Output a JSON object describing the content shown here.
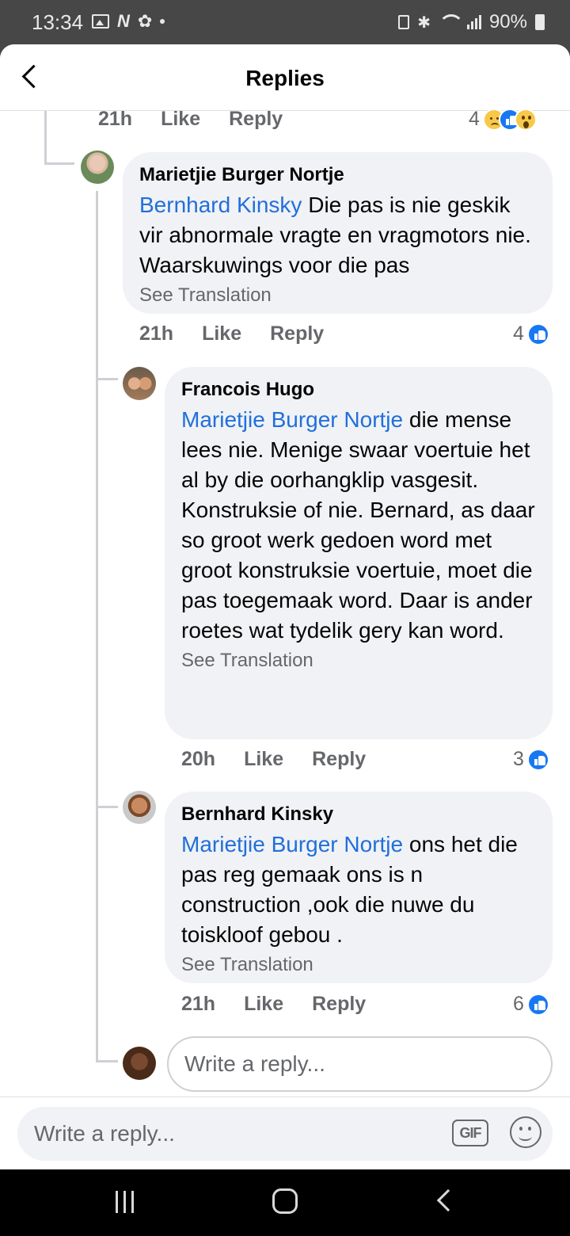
{
  "status_bar": {
    "time": "13:34",
    "battery": "90%"
  },
  "header": {
    "title": "Replies"
  },
  "top_row": {
    "time": "21h",
    "like": "Like",
    "reply": "Reply",
    "reaction_count": "4"
  },
  "comments": [
    {
      "author": "Marietjie Burger Nortje",
      "mention": "Bernhard Kinsky",
      "text": " Die pas is nie geskik vir abnormale vragte en vragmotors nie.  Waarskuwings voor die pas",
      "see_translation": "See Translation",
      "time": "21h",
      "like": "Like",
      "reply": "Reply",
      "reaction_count": "4"
    },
    {
      "author": "Francois Hugo",
      "mention": "Marietjie Burger Nortje",
      "text": " die mense lees nie. Menige swaar voertuie het al by die oorhangklip vasgesit. Konstruksie of nie. Bernard, as daar so groot werk gedoen word met groot konstruksie voertuie, moet die pas toegemaak word. Daar is ander roetes wat tydelik gery kan word.",
      "see_translation": "See Translation",
      "time": "20h",
      "like": "Like",
      "reply": "Reply",
      "reaction_count": "3"
    },
    {
      "author": "Bernhard Kinsky",
      "mention": "Marietjie Burger Nortje",
      "text": " ons het die pas reg gemaak ons is n construction ,ook die nuwe du toiskloof gebou .",
      "see_translation": "See Translation",
      "time": "21h",
      "like": "Like",
      "reply": "Reply",
      "reaction_count": "6"
    }
  ],
  "inline_reply": {
    "placeholder": "Write a reply..."
  },
  "composer": {
    "placeholder": "Write a reply...",
    "gif_label": "GIF"
  },
  "colors": {
    "accent": "#1877f2",
    "mention": "#216fdb",
    "bubble": "#f0f2f5",
    "muted": "#65676b"
  },
  "icons": [
    "back-chevron-icon",
    "like-icon",
    "sad-icon",
    "wow-icon",
    "gif-icon",
    "emoji-icon"
  ]
}
